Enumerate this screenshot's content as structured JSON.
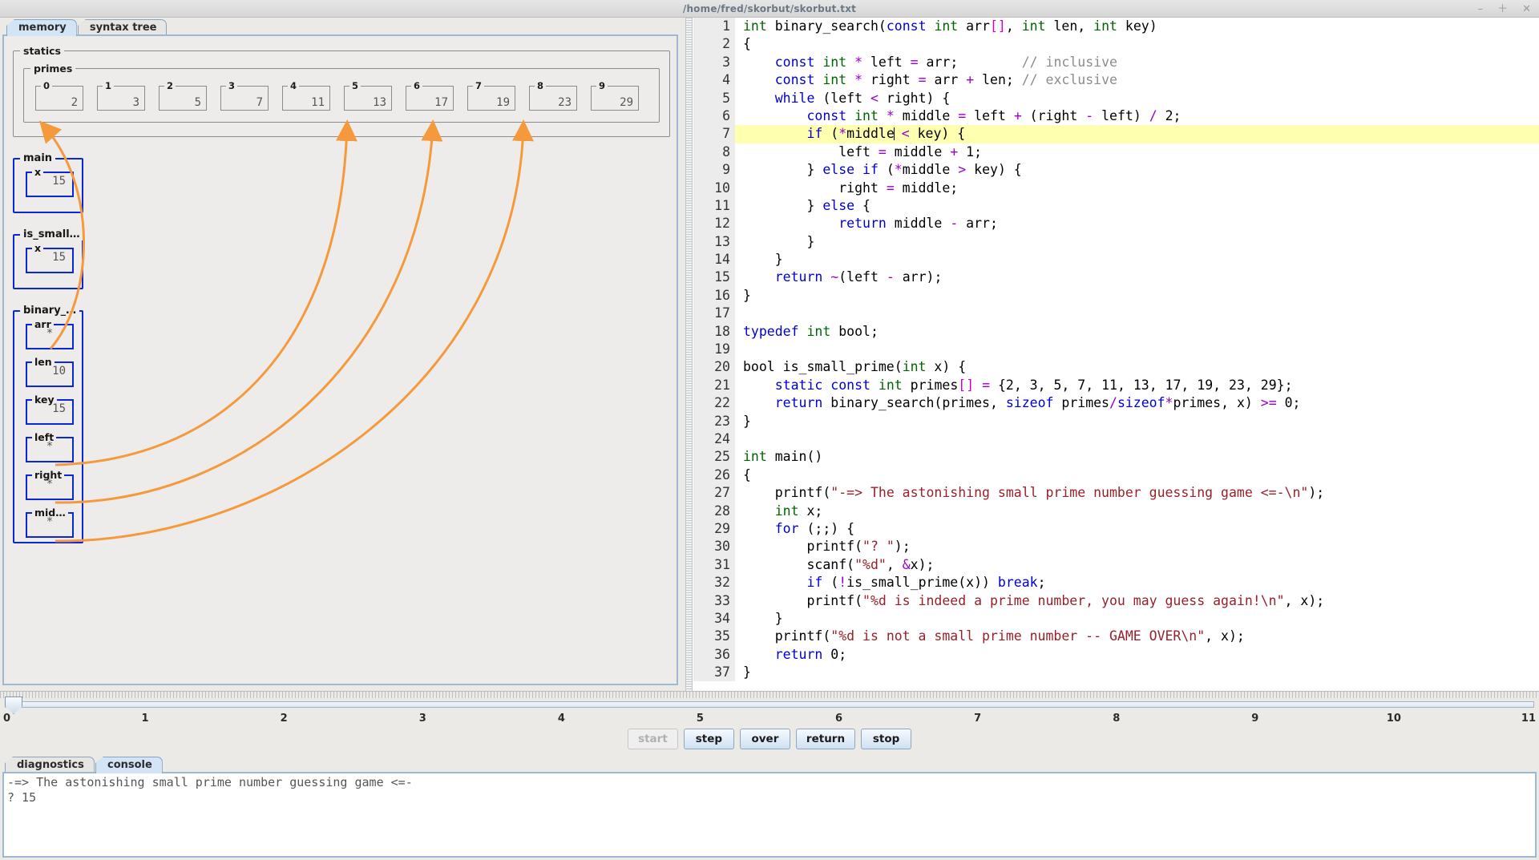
{
  "window": {
    "title": "/home/fred/skorbut/skorbut.txt",
    "controls": [
      {
        "name": "minimize",
        "glyph": "–"
      },
      {
        "name": "maximize",
        "glyph": "＋"
      },
      {
        "name": "close",
        "glyph": "✕"
      }
    ]
  },
  "left_panel": {
    "tabs": [
      {
        "label": "memory",
        "selected": true
      },
      {
        "label": "syntax tree",
        "selected": false
      }
    ],
    "statics": {
      "label": "statics",
      "arrays": [
        {
          "label": "primes",
          "indices": [
            "0",
            "1",
            "2",
            "3",
            "4",
            "5",
            "6",
            "7",
            "8",
            "9"
          ],
          "values": [
            "2",
            "3",
            "5",
            "7",
            "11",
            "13",
            "17",
            "19",
            "23",
            "29"
          ]
        }
      ]
    },
    "frames": [
      {
        "label": "main",
        "vars": [
          {
            "label": "x",
            "value": "15",
            "pointer": false
          }
        ]
      },
      {
        "label": "is_small…",
        "vars": [
          {
            "label": "x",
            "value": "15",
            "pointer": false
          }
        ]
      },
      {
        "label": "binary_…",
        "vars": [
          {
            "label": "arr",
            "value": "*",
            "pointer": true
          },
          {
            "label": "len",
            "value": "10",
            "pointer": false
          },
          {
            "label": "key",
            "value": "15",
            "pointer": false
          },
          {
            "label": "left",
            "value": "*",
            "pointer": true
          },
          {
            "label": "right",
            "value": "*",
            "pointer": true
          },
          {
            "label": "mid…",
            "value": "*",
            "pointer": true
          }
        ]
      }
    ],
    "pointer_color": "#f59a3c"
  },
  "editor": {
    "highlighted_line": 7,
    "lines": [
      {
        "n": "1",
        "html": "<span class=\"t\">int</span> binary_search(<span class=\"k\">const</span> <span class=\"t\">int</span> arr<span class=\"b\">[]</span>, <span class=\"t\">int</span> len, <span class=\"t\">int</span> key)"
      },
      {
        "n": "2",
        "html": "{"
      },
      {
        "n": "3",
        "html": "    <span class=\"k\">const</span> <span class=\"t\">int</span> <span class=\"p\">*</span> left <span class=\"p\">=</span> arr;        <span class=\"c\">// inclusive</span>"
      },
      {
        "n": "4",
        "html": "    <span class=\"k\">const</span> <span class=\"t\">int</span> <span class=\"p\">*</span> right <span class=\"p\">=</span> arr <span class=\"p\">+</span> len; <span class=\"c\">// exclusive</span>"
      },
      {
        "n": "5",
        "html": "    <span class=\"k\">while</span> (left <span class=\"p\">&lt;</span> right) {"
      },
      {
        "n": "6",
        "html": "        <span class=\"k\">const</span> <span class=\"t\">int</span> <span class=\"p\">*</span> middle <span class=\"p\">=</span> left <span class=\"p\">+</span> (right <span class=\"p\">-</span> left) <span class=\"p\">/</span> 2;"
      },
      {
        "n": "7",
        "html": "        <span class=\"k\">if</span> (<span class=\"p\">*</span>middle<span class=\"caret\"></span> <span class=\"p\">&lt;</span> key) {"
      },
      {
        "n": "8",
        "html": "            left <span class=\"p\">=</span> middle <span class=\"p\">+</span> 1;"
      },
      {
        "n": "9",
        "html": "        } <span class=\"k\">else</span> <span class=\"k\">if</span> (<span class=\"p\">*</span>middle <span class=\"p\">&gt;</span> key) {"
      },
      {
        "n": "10",
        "html": "            right <span class=\"p\">=</span> middle;"
      },
      {
        "n": "11",
        "html": "        } <span class=\"k\">else</span> {"
      },
      {
        "n": "12",
        "html": "            <span class=\"k\">return</span> middle <span class=\"p\">-</span> arr;"
      },
      {
        "n": "13",
        "html": "        }"
      },
      {
        "n": "14",
        "html": "    }"
      },
      {
        "n": "15",
        "html": "    <span class=\"k\">return</span> <span class=\"p\">~</span>(left <span class=\"p\">-</span> arr);"
      },
      {
        "n": "16",
        "html": "}"
      },
      {
        "n": "17",
        "html": ""
      },
      {
        "n": "18",
        "html": "<span class=\"k\">typedef</span> <span class=\"t\">int</span> bool;"
      },
      {
        "n": "19",
        "html": ""
      },
      {
        "n": "20",
        "html": "bool is_small_prime(<span class=\"t\">int</span> x) {"
      },
      {
        "n": "21",
        "html": "    <span class=\"k\">static</span> <span class=\"k\">const</span> <span class=\"t\">int</span> primes<span class=\"b\">[]</span> <span class=\"p\">=</span> {2, 3, 5, 7, 11, 13, 17, 19, 23, 29};"
      },
      {
        "n": "22",
        "html": "    <span class=\"k\">return</span> binary_search(primes, <span class=\"k\">sizeof</span> primes<span class=\"p\">/</span><span class=\"k\">sizeof</span><span class=\"p\">*</span>primes, x) <span class=\"p\">&gt;=</span> 0;"
      },
      {
        "n": "23",
        "html": "}"
      },
      {
        "n": "24",
        "html": ""
      },
      {
        "n": "25",
        "html": "<span class=\"t\">int</span> main()"
      },
      {
        "n": "26",
        "html": "{"
      },
      {
        "n": "27",
        "html": "    printf(<span class=\"s\">\"-=&gt; The astonishing small prime number guessing game &lt;=-\\n\"</span>);"
      },
      {
        "n": "28",
        "html": "    <span class=\"t\">int</span> x;"
      },
      {
        "n": "29",
        "html": "    <span class=\"k\">for</span> (;;) {"
      },
      {
        "n": "30",
        "html": "        printf(<span class=\"s\">\"? \"</span>);"
      },
      {
        "n": "31",
        "html": "        scanf(<span class=\"s\">\"%d\"</span>, <span class=\"p\">&amp;</span>x);"
      },
      {
        "n": "32",
        "html": "        <span class=\"k\">if</span> (<span class=\"p\">!</span>is_small_prime(x)) <span class=\"k\">break</span>;"
      },
      {
        "n": "33",
        "html": "        printf(<span class=\"s\">\"%d is indeed a prime number, you may guess again!\\n\"</span>, x);"
      },
      {
        "n": "34",
        "html": "    }"
      },
      {
        "n": "35",
        "html": "    printf(<span class=\"s\">\"%d is not a small prime number -- GAME OVER\\n\"</span>, x);"
      },
      {
        "n": "36",
        "html": "    <span class=\"k\">return</span> 0;"
      },
      {
        "n": "37",
        "html": "}"
      }
    ]
  },
  "timeline": {
    "ticks": [
      "0",
      "1",
      "2",
      "3",
      "4",
      "5",
      "6",
      "7",
      "8",
      "9",
      "10",
      "11"
    ],
    "thumb_value": "0"
  },
  "controls": {
    "buttons": [
      {
        "label": "start",
        "enabled": false
      },
      {
        "label": "step",
        "enabled": true
      },
      {
        "label": "over",
        "enabled": true
      },
      {
        "label": "return",
        "enabled": true
      },
      {
        "label": "stop",
        "enabled": true
      }
    ]
  },
  "bottom_panel": {
    "tabs": [
      {
        "label": "diagnostics",
        "selected": false
      },
      {
        "label": "console",
        "selected": true
      }
    ],
    "console_text": "-=> The astonishing small prime number guessing game <=-\n? 15"
  }
}
